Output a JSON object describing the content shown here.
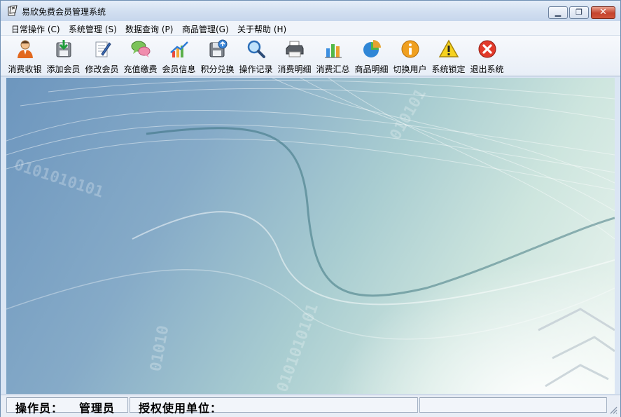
{
  "window": {
    "title": "易欣免费会员管理系统"
  },
  "menu": [
    {
      "label": "日常操作 (C)",
      "name": "menu-daily"
    },
    {
      "label": "系统管理 (S)",
      "name": "menu-system"
    },
    {
      "label": "数据查询 (P)",
      "name": "menu-query"
    },
    {
      "label": "商品管理(G)",
      "name": "menu-goods"
    },
    {
      "label": "关于帮助 (H)",
      "name": "menu-help"
    }
  ],
  "toolbar": [
    {
      "label": "消费收银",
      "icon": "cashier-user-icon"
    },
    {
      "label": "添加会员",
      "icon": "add-disk-icon"
    },
    {
      "label": "修改会员",
      "icon": "edit-note-icon"
    },
    {
      "label": "充值缴费",
      "icon": "chat-bubbles-icon"
    },
    {
      "label": "会员信息",
      "icon": "chart-up-icon"
    },
    {
      "label": "积分兑换",
      "icon": "save-disk-icon"
    },
    {
      "label": "操作记录",
      "icon": "magnifier-icon"
    },
    {
      "label": "消费明细",
      "icon": "printer-icon"
    },
    {
      "label": "消费汇总",
      "icon": "bar-chart-icon"
    },
    {
      "label": "商品明细",
      "icon": "pie-chart-icon"
    },
    {
      "label": "切换用户",
      "icon": "info-icon"
    },
    {
      "label": "系统锁定",
      "icon": "warning-icon"
    },
    {
      "label": "退出系统",
      "icon": "exit-x-icon"
    }
  ],
  "status": {
    "operator_label": "操作员：",
    "operator_value": "管理员",
    "license_label": "授权使用单位："
  },
  "colors": {
    "title_gradient_top": "#e6eef9",
    "close_red": "#c4432e",
    "bg_blue": "#6d96be",
    "bg_teal": "#a9cdd1"
  }
}
